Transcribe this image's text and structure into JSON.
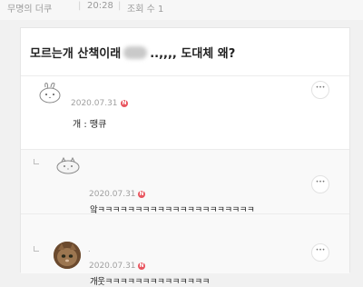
{
  "top_meta": {
    "author": "무명의 더쿠",
    "time": "20:28",
    "views": "조회 수 1"
  },
  "post": {
    "title_part1": "모르는개 산책이래",
    "title_part2": "..,,,, 도대체 왜?"
  },
  "comments": [
    {
      "date": "2020.07.31",
      "badge": "N",
      "text": "개 : 땡큐",
      "more_label": "•••",
      "avatar": "bunny-doodle-avatar"
    },
    {
      "date": "2020.07.31",
      "badge": "N",
      "text": "앜ㅋㅋㅋㅋㅋㅋㅋㅋㅋㅋㅋㅋㅋㅋㅋㅋㅋㅋㅋㅋㅋ",
      "more_label": "•••",
      "avatar": "animal-doodle-avatar",
      "is_reply": true
    },
    {
      "date": "2020.07.31",
      "badge": "N",
      "text": "개웃ㅋㅋㅋㅋㅋㅋㅋㅋㅋㅋㅋㅋㅋㅋ",
      "more_label": "•••",
      "avatar": "cat-photo-avatar",
      "is_reply": true,
      "name_dot": "."
    }
  ],
  "colors": {
    "badge": "#e8555f",
    "background": "#f1f1f1",
    "card": "#ffffff",
    "meta_text": "#9a9a9a"
  }
}
